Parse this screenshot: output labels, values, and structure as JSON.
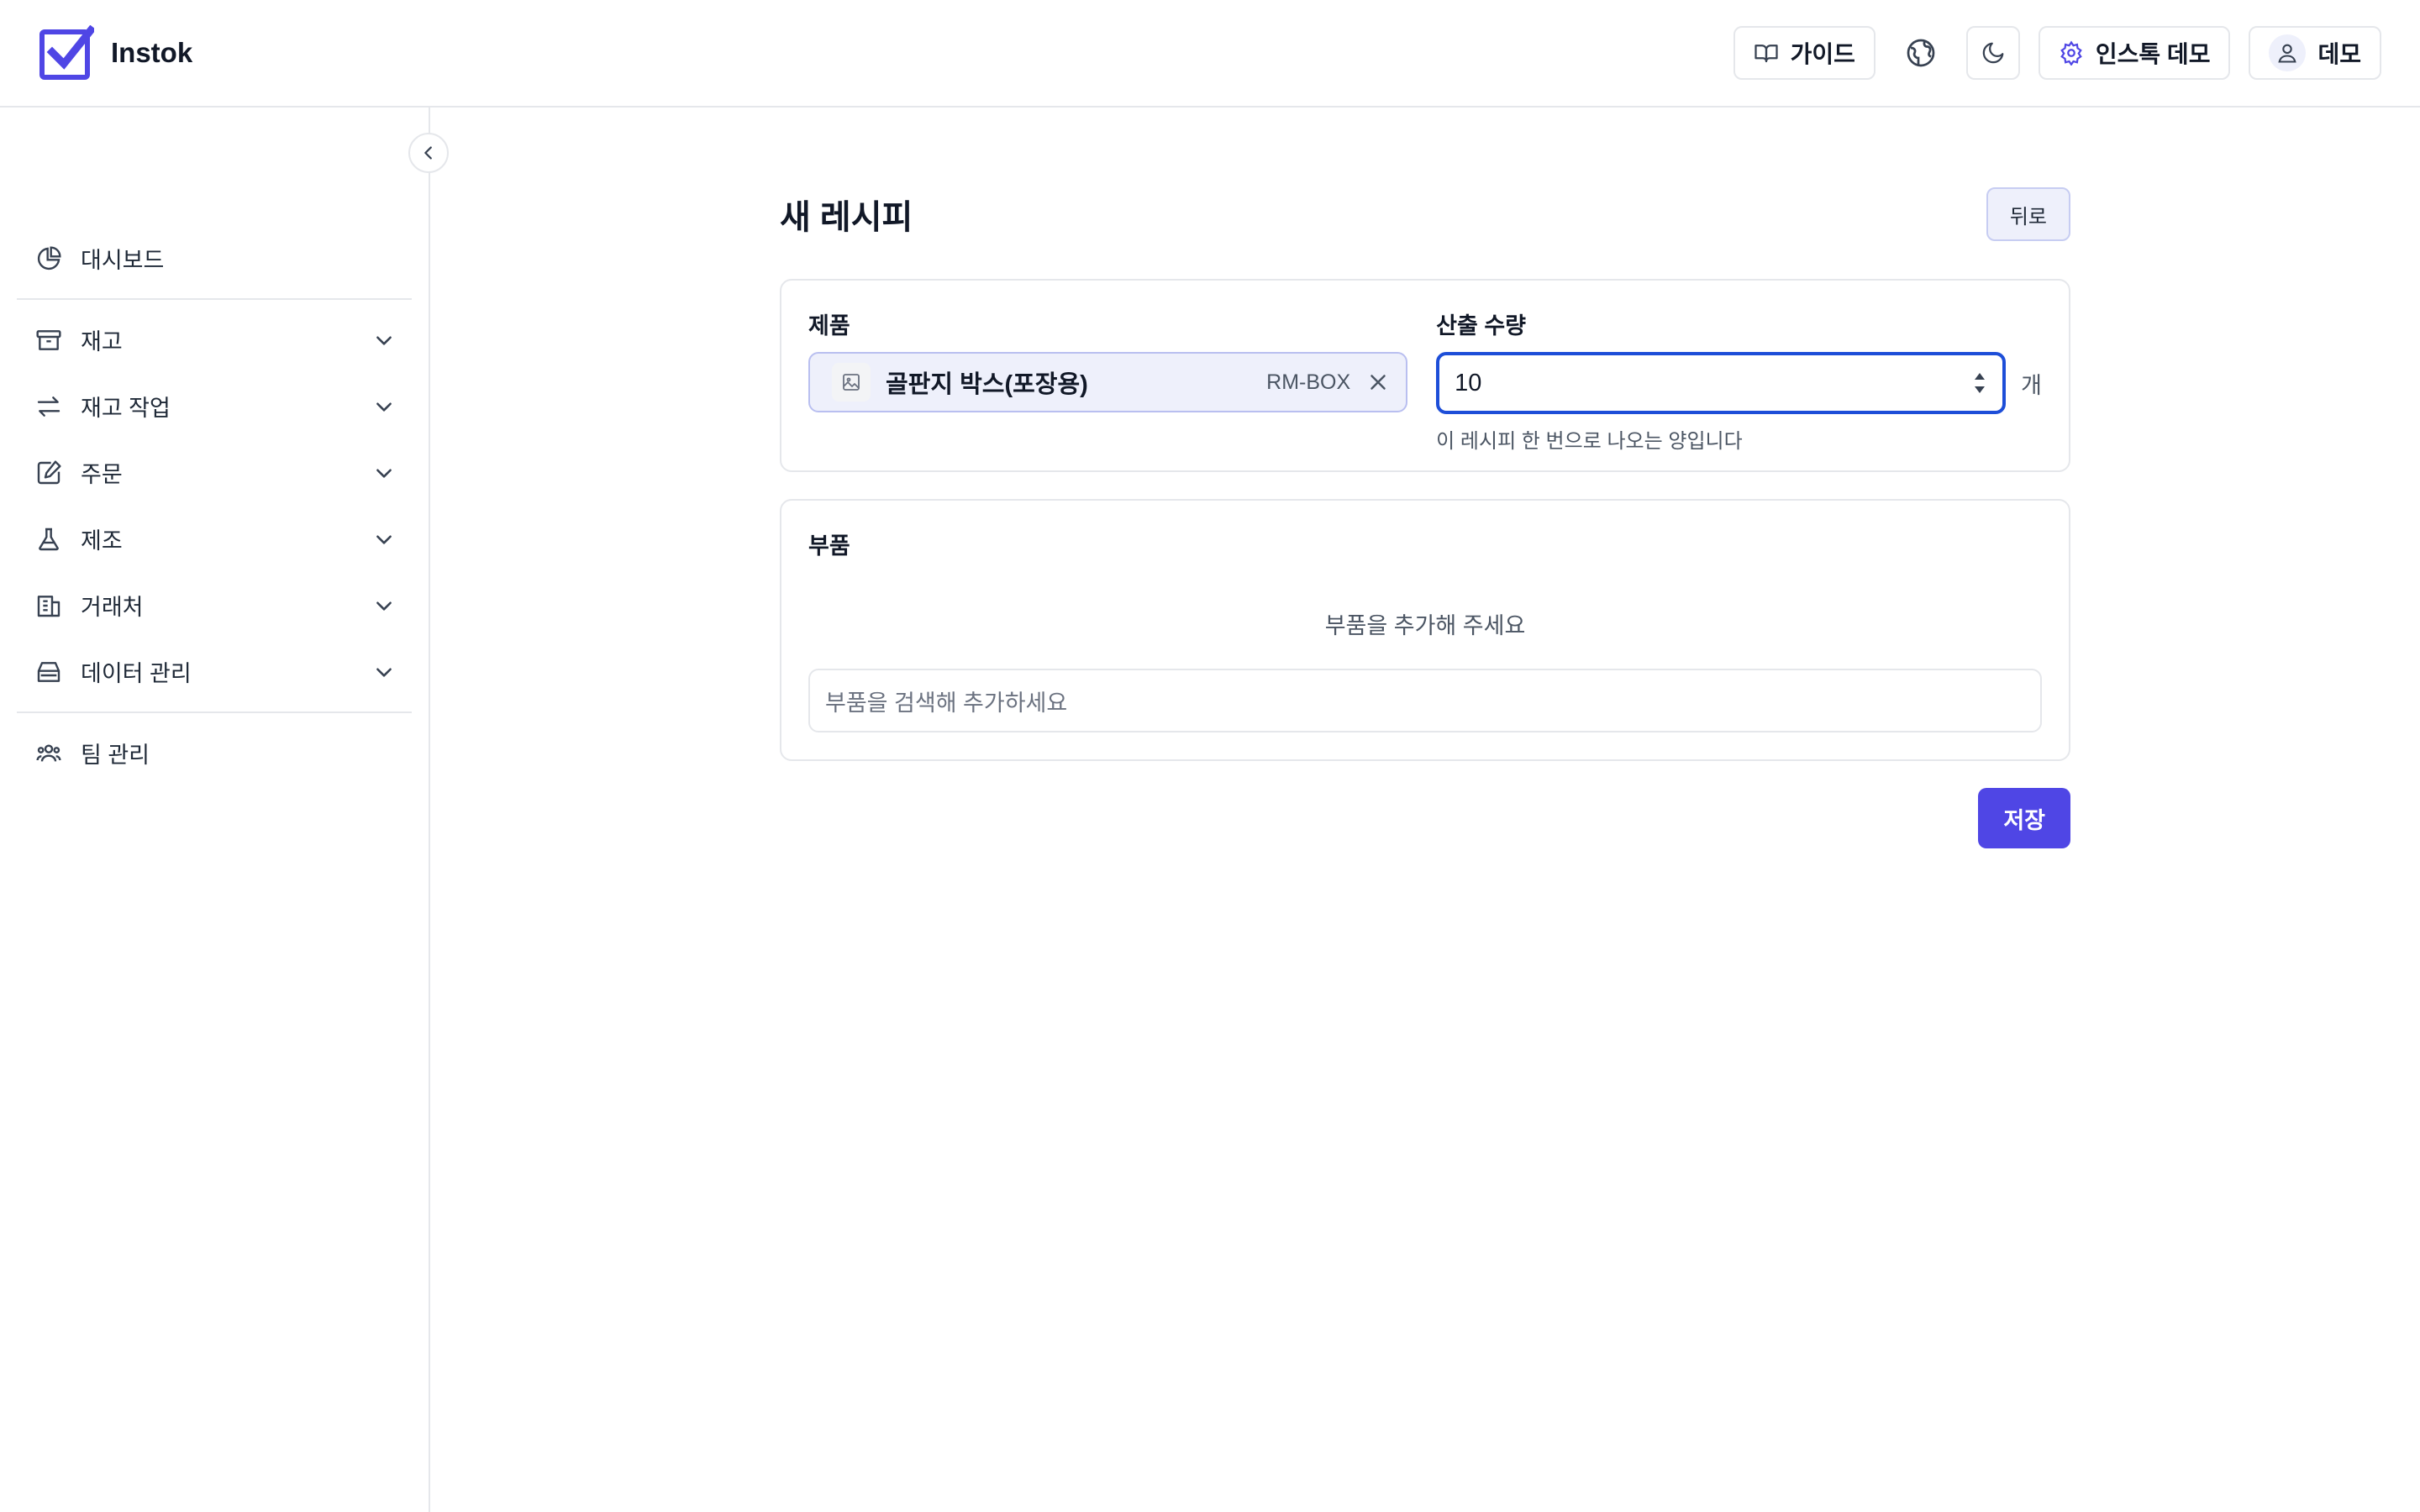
{
  "app": {
    "name": "Instok",
    "brand_color": "#4f46e5"
  },
  "header": {
    "guide_label": "가이드",
    "org_label": "인스톡 데모",
    "user_label": "데모",
    "icons": [
      "book-open-icon",
      "globe-icon",
      "moon-icon",
      "gear-icon",
      "user-icon"
    ]
  },
  "sidebar": {
    "items": [
      {
        "label": "대시보드",
        "icon": "pie-chart-icon"
      },
      {
        "label": "재고",
        "icon": "archive-box-icon"
      },
      {
        "label": "재고 작업",
        "icon": "arrows-exchange-icon"
      },
      {
        "label": "주문",
        "icon": "edit-document-icon"
      },
      {
        "label": "제조",
        "icon": "flask-icon"
      },
      {
        "label": "거래처",
        "icon": "building-icon"
      },
      {
        "label": "데이터 관리",
        "icon": "database-icon"
      },
      {
        "label": "팀 관리",
        "icon": "users-icon"
      }
    ]
  },
  "page": {
    "title": "새 레시피",
    "back_label": "뒤로"
  },
  "product": {
    "label": "제품",
    "name": "골판지 박스(포장용)",
    "sku": "RM-BOX"
  },
  "output": {
    "label": "산출 수량",
    "value": "10",
    "unit": "개",
    "help": "이 레시피 한 번으로 나오는 양입니다"
  },
  "components": {
    "title": "부품",
    "empty_message": "부품을 추가해 주세요",
    "search_placeholder": "부품을 검색해 추가하세요"
  },
  "actions": {
    "save_label": "저장"
  }
}
